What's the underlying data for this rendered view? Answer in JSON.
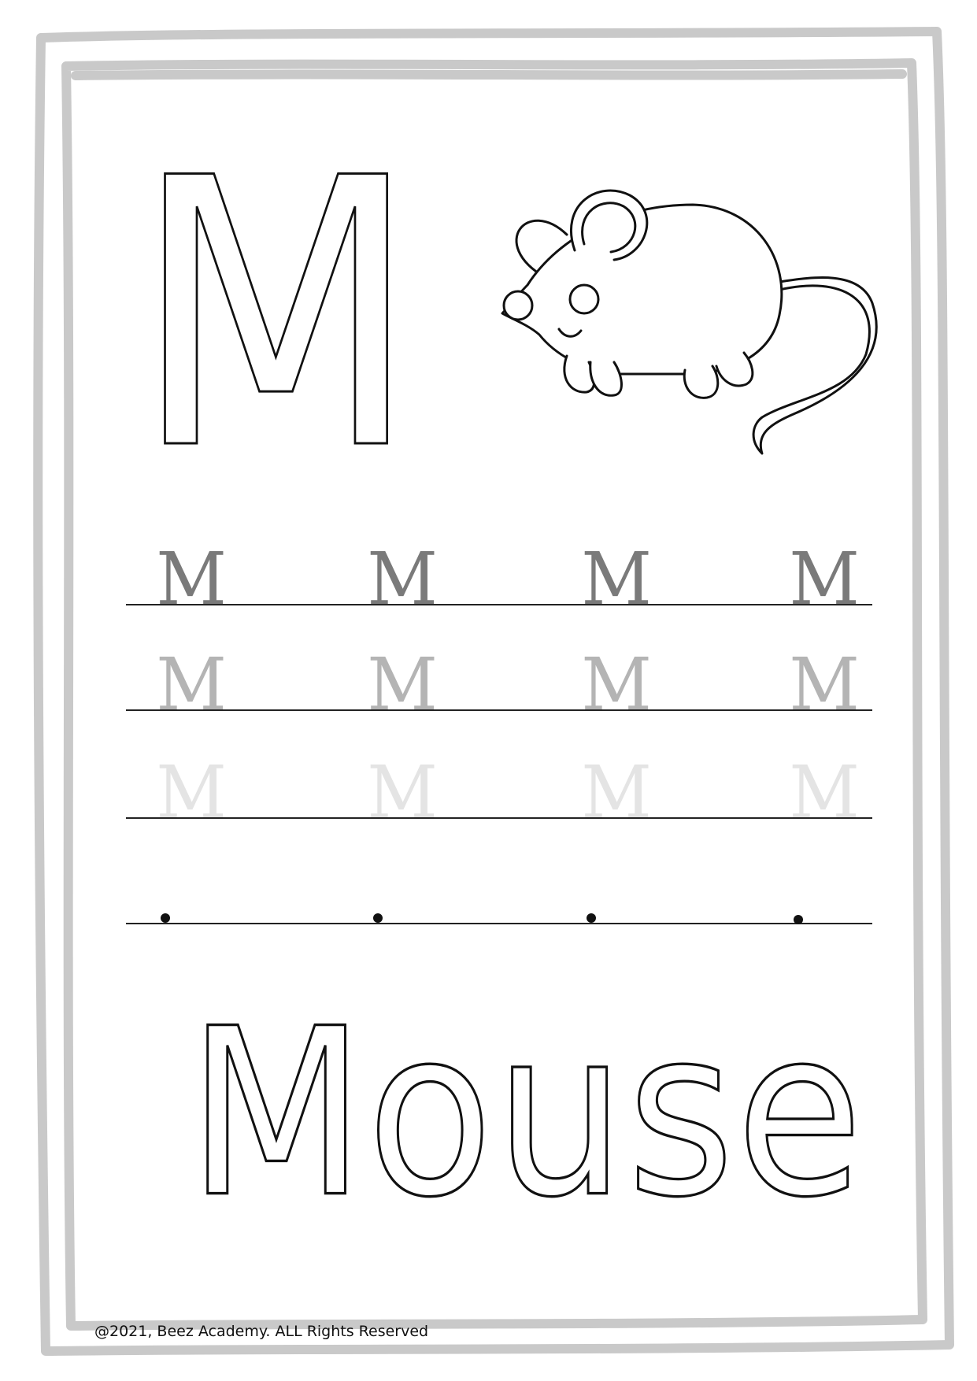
{
  "worksheet": {
    "letter": "M",
    "word": "Mouse",
    "trace_rows": [
      {
        "letters": [
          "M",
          "M",
          "M",
          "M"
        ],
        "color": "#7a7a7a"
      },
      {
        "letters": [
          "M",
          "M",
          "M",
          "M"
        ],
        "color": "#b4b4b4"
      },
      {
        "letters": [
          "M",
          "M",
          "M",
          "M"
        ],
        "color": "#e4e4e4"
      }
    ],
    "footer": "@2021, Beez Academy. ALL Rights Reserved"
  },
  "colors": {
    "frame": "#c9c9c9",
    "ink": "#111111"
  },
  "icons": [
    "mouse-illustration"
  ]
}
